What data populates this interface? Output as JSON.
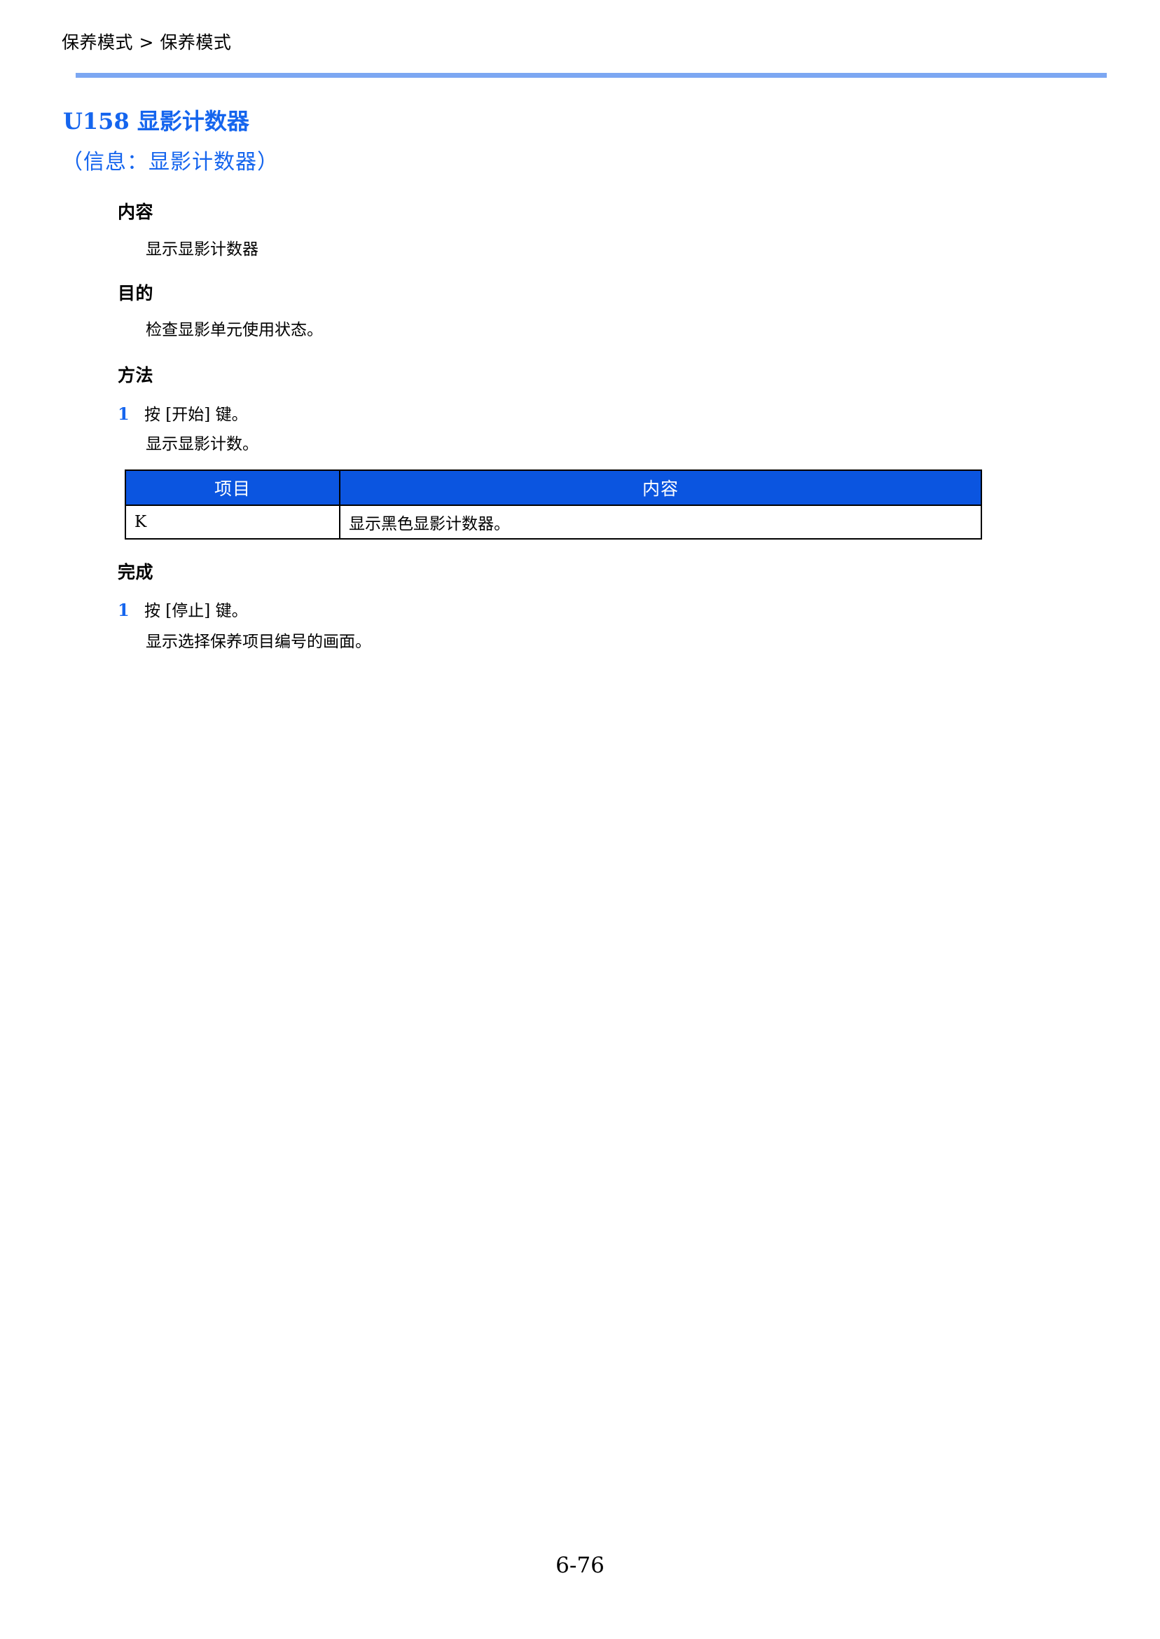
{
  "header": {
    "breadcrumb": "保养模式 > 保养模式",
    "rule_color": "#7CA7F2"
  },
  "title": {
    "code": "U158",
    "name": "显影计数器",
    "subtitle": "（信息：显影计数器）",
    "color": "#1565EE"
  },
  "sections": {
    "content": {
      "heading": "内容",
      "body": "显示显影计数器"
    },
    "purpose": {
      "heading": "目的",
      "body": "检查显影单元使用状态。"
    },
    "method": {
      "heading": "方法",
      "step_number": "1",
      "step_text": "按 [开始] 键。",
      "step_detail": "显示显影计数。"
    },
    "completion": {
      "heading": "完成",
      "step_number": "1",
      "step_text": "按 [停止] 键。",
      "step_detail": "显示选择保养项目编号的画面。"
    }
  },
  "table": {
    "header_color": "#0B55E0",
    "columns": [
      "项目",
      "内容"
    ],
    "rows": [
      {
        "item": "K",
        "description": "显示黑色显影计数器。"
      }
    ]
  },
  "footer": {
    "page_number": "6-76"
  }
}
